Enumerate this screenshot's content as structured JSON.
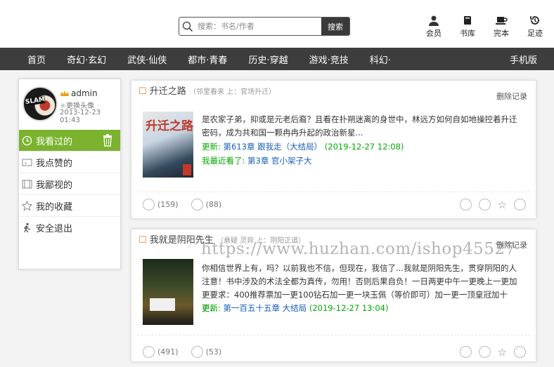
{
  "search": {
    "placeholder": "搜索：书名/作者",
    "button": "搜索"
  },
  "toplinks": [
    {
      "label": "会员",
      "icon": "member-icon"
    },
    {
      "label": "书库",
      "icon": "book-icon"
    },
    {
      "label": "完本",
      "icon": "cup-icon"
    },
    {
      "label": "足迹",
      "icon": "history-icon"
    }
  ],
  "nav": {
    "items": [
      "首页",
      "奇幻·玄幻",
      "武侠·仙侠",
      "都市·青春",
      "历史·穿越",
      "游戏·竞技",
      "科幻·"
    ],
    "mobile": "手机版"
  },
  "sidebar": {
    "username": "admin",
    "change_avatar": "更换头像",
    "date": "2013-12-23 01:43",
    "menu": [
      {
        "label": "我看过的",
        "icon": "clock-icon"
      },
      {
        "label": "我点赞的",
        "icon": "thumb-icon"
      },
      {
        "label": "我鄙视的",
        "icon": "film-icon"
      },
      {
        "label": "我的收藏",
        "icon": "star-icon"
      },
      {
        "label": "安全退出",
        "icon": "exit-icon"
      }
    ]
  },
  "cards": [
    {
      "title": "升迁之路",
      "title_sub": "（邻里春来 上：官场升迁）",
      "delete": "删除记录",
      "cover_text": "升迁之路",
      "desc": "是农家子弟，抑或是元老后裔？且看在扑朔迷离的身世中，林远方如何自如地操控着升迁密码，成为共和国一颗冉冉升起的政治新星...",
      "update_label": "更新:",
      "update_chapter": "第613章 跟我走（大结局）",
      "update_time": "(2019-12-27 12:08)",
      "recent_label": "我最近看了:",
      "recent_chapter": "第3章 官小架子大",
      "likes": "(159)",
      "dislikes": "(88)"
    },
    {
      "title": "我就是阴阳先生",
      "title_sub": "（悬疑 灵异 上：阴阳正道）",
      "delete": "删除记录",
      "desc": "你相信世界上有，吗？以前我也不信，但现在，我信了...我就是阴阳先生，贯穿阴阳的人注意！书中涉及的术法全都为真传，勿用！否则后果自负！一日两更中午一更晚上一更加更要求：400推荐票加一更100钻石加一更一块玉佩（等价即可）加一更一顶皇冠加十更...",
      "update_label": "更新:",
      "update_chapter": "第一百五十五章 大结局",
      "update_time": "(2019-12-27 13:04)",
      "likes": "(491)",
      "dislikes": "(53)"
    }
  ],
  "watermark": "https://www.huzhan.com/ishop45527"
}
